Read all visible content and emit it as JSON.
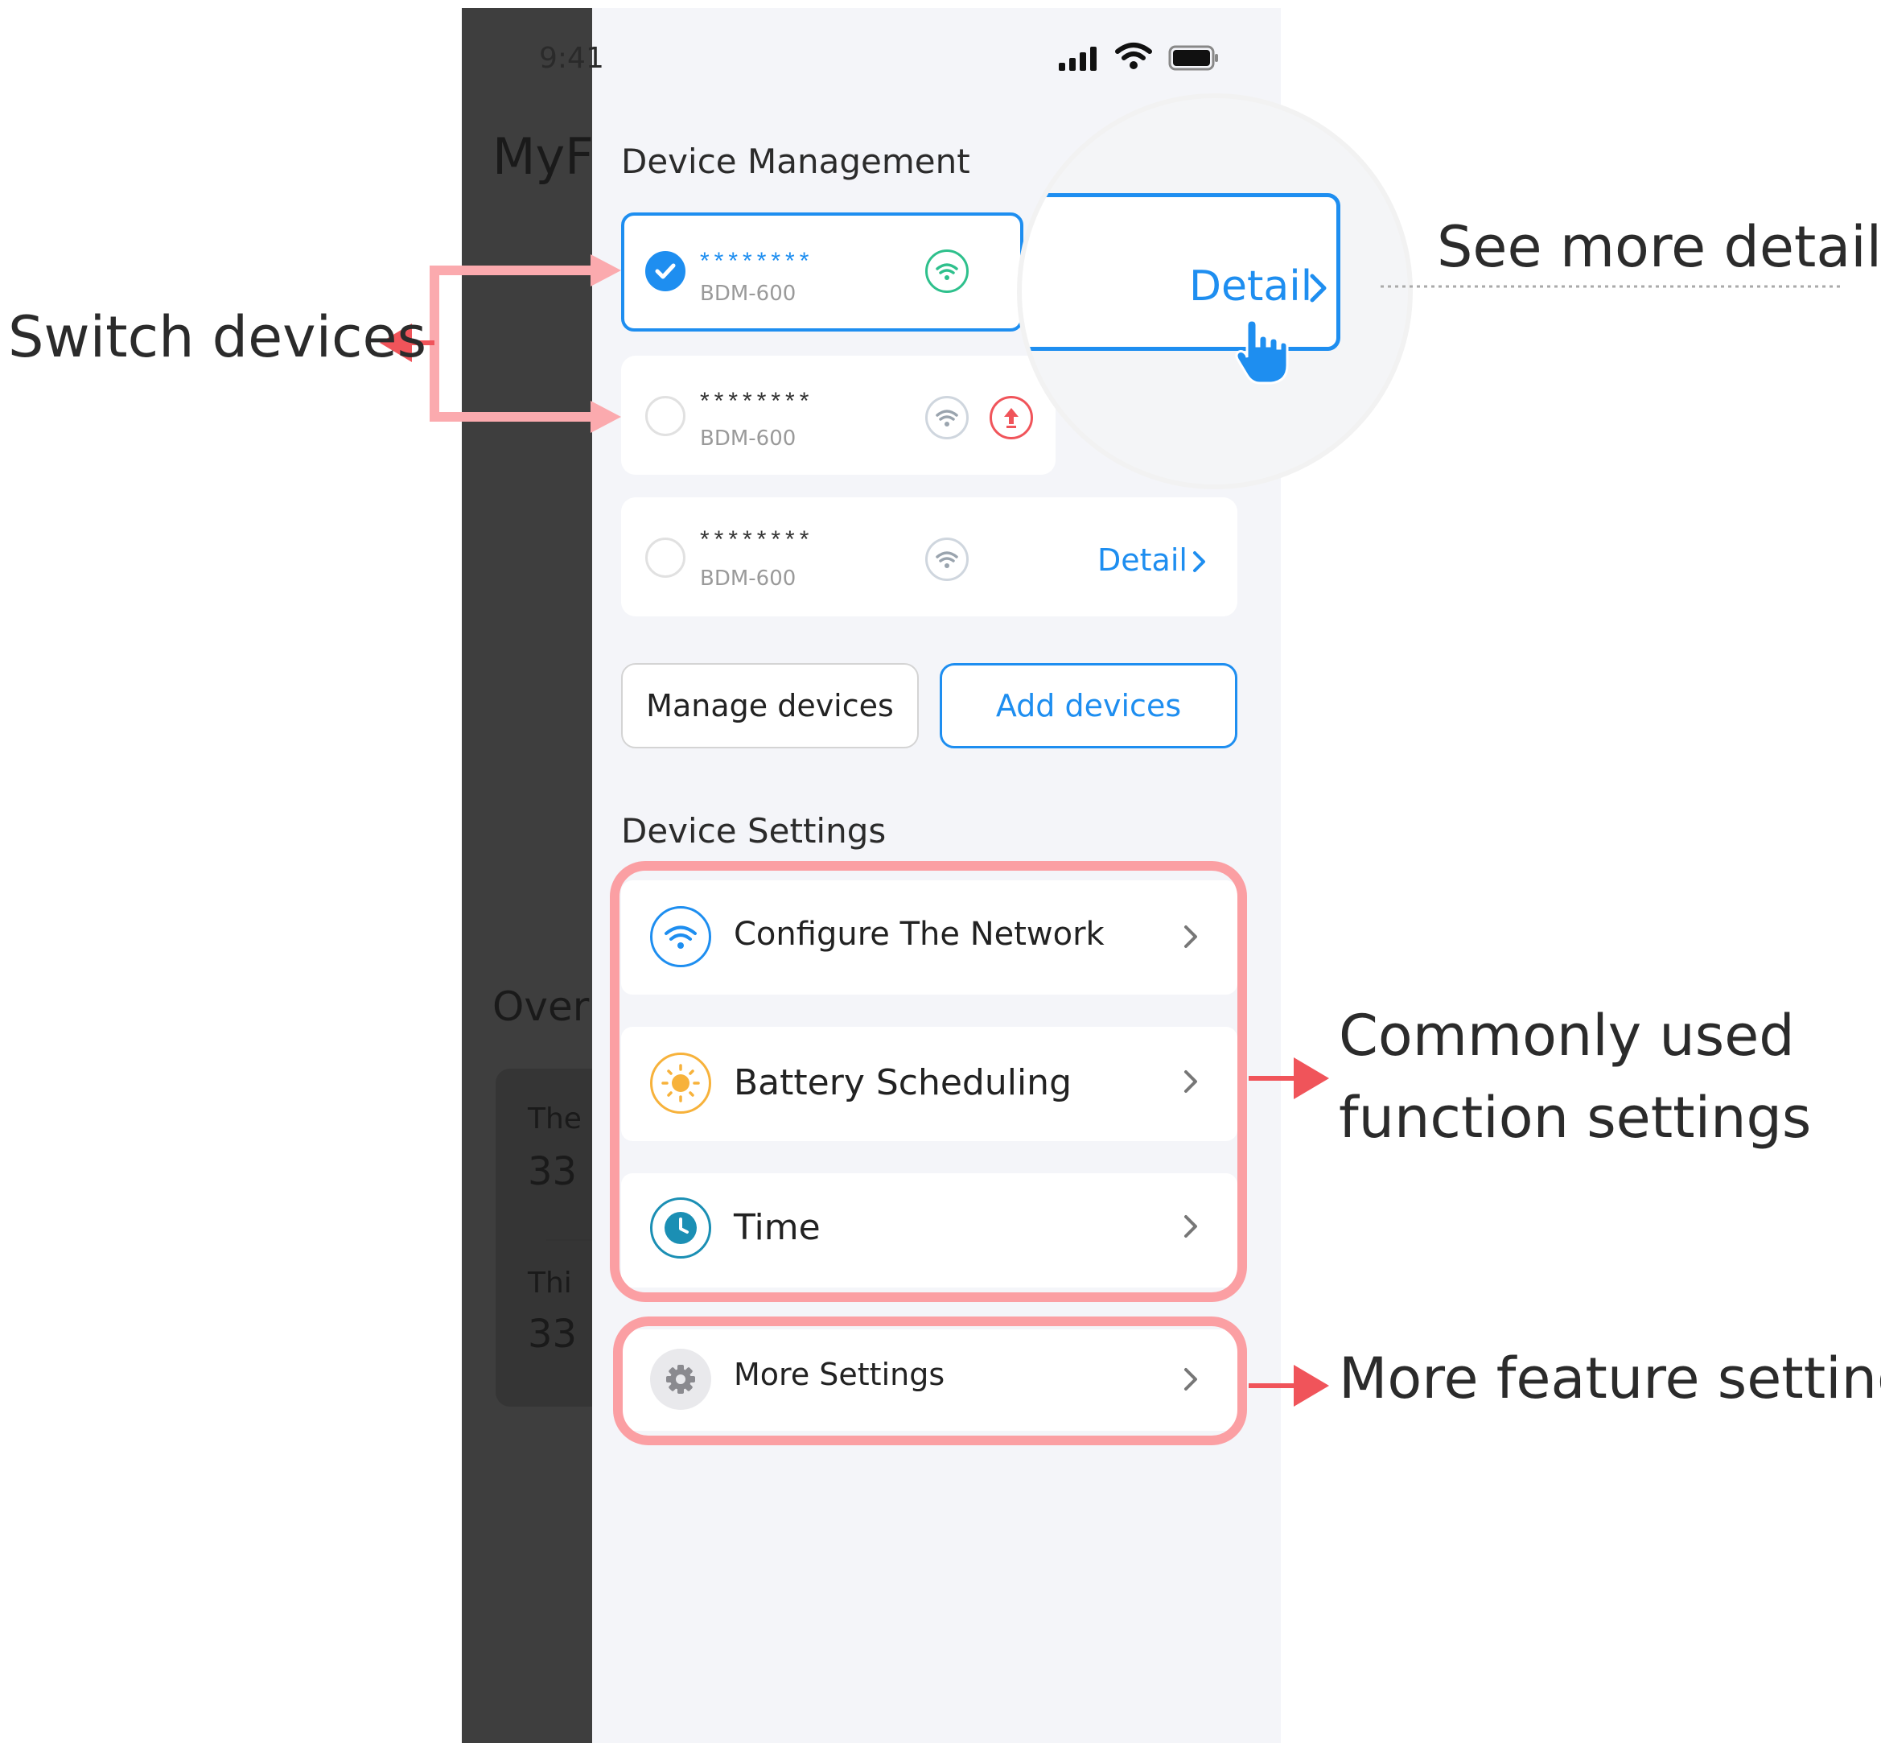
{
  "status_bar": {
    "time": "9:41"
  },
  "background_app": {
    "title_fragment": "MyF",
    "overview_fragment": "Over",
    "row1_label": "The",
    "row1_value": "33",
    "row2_label": "Thi",
    "row2_value": "33"
  },
  "device_management": {
    "title": "Device Management",
    "devices": [
      {
        "name": "********",
        "model": "BDM-600",
        "selected": true,
        "wifi": "connected",
        "detail": "Detail"
      },
      {
        "name": "********",
        "model": "BDM-600",
        "selected": false,
        "wifi": "disconnected",
        "upgrade": true
      },
      {
        "name": "********",
        "model": "BDM-600",
        "selected": false,
        "wifi": "disconnected",
        "detail": "Detail"
      }
    ],
    "manage_button": "Manage devices",
    "add_button": "Add devices"
  },
  "magnifier": {
    "detail": "Detail"
  },
  "device_settings": {
    "title": "Device Settings",
    "items": [
      {
        "label": "Configure The Network",
        "icon": "wifi-icon"
      },
      {
        "label": "Battery Scheduling",
        "icon": "sun-icon"
      },
      {
        "label": "Time",
        "icon": "clock-icon"
      }
    ],
    "more": {
      "label": "More Settings",
      "icon": "gear-icon"
    }
  },
  "annotations": {
    "switch_devices": "Switch devices",
    "see_more_details": "See more details",
    "commonly_used_line1": "Commonly used",
    "commonly_used_line2": "function settings",
    "more_feature_settings": "More feature settings"
  },
  "colors": {
    "accent": "#1e8ef0",
    "highlight": "#fb9fa3",
    "arrow": "#f0545a",
    "wifi_green": "#2ec08c",
    "upgrade_red": "#f0545a",
    "sun": "#f7b23b",
    "panel_bg": "#f4f5f9",
    "dim_bg": "#3e3e3e"
  }
}
